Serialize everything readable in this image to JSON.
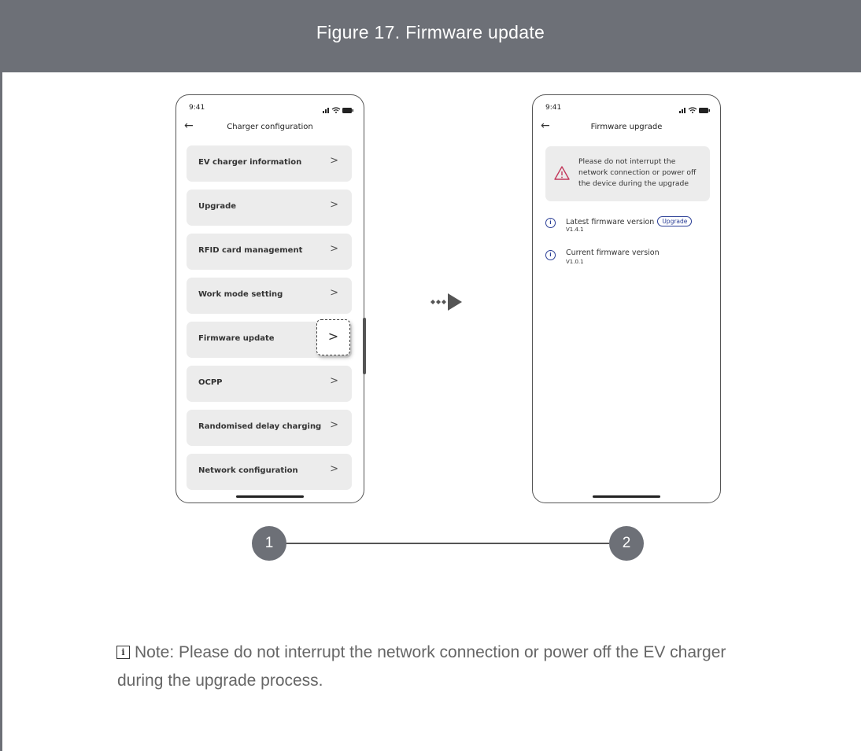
{
  "header": {
    "title": "Figure 17.  Firmware update"
  },
  "phone1": {
    "status_time": "9:41",
    "title": "Charger configuration",
    "items": [
      {
        "label": "EV charger information",
        "chevron": ">"
      },
      {
        "label": "Upgrade",
        "chevron": ">"
      },
      {
        "label": "RFID card management",
        "chevron": ">"
      },
      {
        "label": "Work mode setting",
        "chevron": ">"
      },
      {
        "label": "Firmware update",
        "chevron": ">"
      },
      {
        "label": "OCPP",
        "chevron": ">"
      },
      {
        "label": "Randomised delay charging",
        "chevron": ">"
      },
      {
        "label": "Network configuration",
        "chevron": ">"
      }
    ]
  },
  "phone2": {
    "status_time": "9:41",
    "title": "Firmware upgrade",
    "warning_lines": [
      "Please do not interrupt the",
      "network connection or power off",
      "the device during the upgrade"
    ],
    "latest_title": "Latest firmware version",
    "latest_value": "V1.4.1",
    "upgrade_button": "Upgrade",
    "current_title": "Current firmware version",
    "current_value": "V1.0.1"
  },
  "steps": {
    "first": "1",
    "second": "2"
  },
  "note": {
    "icon": "i",
    "text": "Note: Please do not interrupt the network connection or power off the EV charger during the upgrade process."
  },
  "icons": {
    "back": "back-arrow-icon",
    "warning": "warning-triangle-icon",
    "info": "info-circle-icon"
  },
  "colors": {
    "header": "#6d7077",
    "accent_blue": "#2a3e96",
    "warning_red": "#c2395c"
  }
}
